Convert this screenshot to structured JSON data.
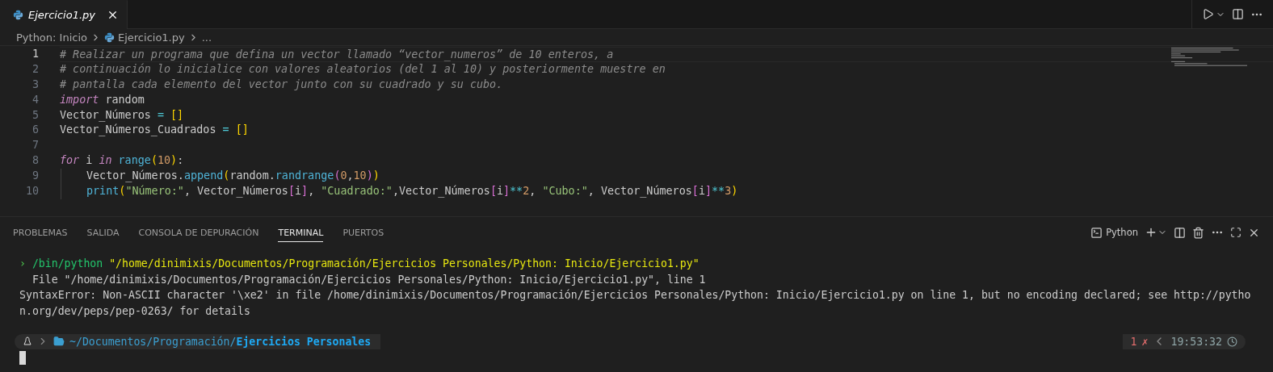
{
  "editor_tabs": [
    {
      "label": "Ejercicio1.py",
      "selected": true
    }
  ],
  "breadcrumb": [
    "Python: Inicio",
    "Ejercicio1.py",
    "..."
  ],
  "code_lines": [
    {
      "number": "1",
      "current": true,
      "indented": false,
      "tokens": [
        {
          "kind": "comment",
          "t": "# Realizar un programa que defina un vector llamado “vector_numeros” de 10 enteros, a"
        }
      ]
    },
    {
      "number": "2",
      "current": false,
      "indented": false,
      "tokens": [
        {
          "kind": "comment",
          "t": "# continuación lo inicialice con valores aleatorios (del 1 al 10) y posteriormente muestre en"
        }
      ]
    },
    {
      "number": "3",
      "current": false,
      "indented": false,
      "tokens": [
        {
          "kind": "comment",
          "t": "# pantalla cada elemento del vector junto con su cuadrado y su cubo."
        }
      ]
    },
    {
      "number": "4",
      "current": false,
      "indented": false,
      "tokens": [
        {
          "kind": "keyword",
          "t": "import"
        },
        {
          "kind": "plain",
          "t": " random"
        }
      ]
    },
    {
      "number": "5",
      "current": false,
      "indented": false,
      "tokens": [
        {
          "kind": "plain",
          "t": "Vector_Números "
        },
        {
          "kind": "operator",
          "t": "= "
        },
        {
          "kind": "bracket",
          "t": "[]"
        }
      ]
    },
    {
      "number": "6",
      "current": false,
      "indented": false,
      "tokens": [
        {
          "kind": "plain",
          "t": "Vector_Números_Cuadrados "
        },
        {
          "kind": "operator",
          "t": "= "
        },
        {
          "kind": "bracket",
          "t": "[]"
        }
      ]
    },
    {
      "number": "7",
      "current": false,
      "indented": false
    },
    {
      "number": "8",
      "current": false,
      "indented": false,
      "tokens": [
        {
          "kind": "keyword",
          "t": "for"
        },
        {
          "kind": "plain",
          "t": " i "
        },
        {
          "kind": "keyword",
          "t": "in"
        },
        {
          "kind": "function",
          "t": " range"
        },
        {
          "kind": "bracket",
          "t": "("
        },
        {
          "kind": "number",
          "t": "10"
        },
        {
          "kind": "bracket",
          "t": ")"
        },
        {
          "kind": "plain",
          "t": ":"
        }
      ]
    },
    {
      "number": "9",
      "current": false,
      "indented": true,
      "tokens": [
        {
          "kind": "plain",
          "t": "Vector_Números."
        },
        {
          "kind": "function",
          "t": "append"
        },
        {
          "kind": "bracket",
          "t": "("
        },
        {
          "kind": "plain",
          "t": "random."
        },
        {
          "kind": "function",
          "t": "randrange"
        },
        {
          "kind": "bracket2",
          "t": "("
        },
        {
          "kind": "number",
          "t": "0"
        },
        {
          "kind": "plain",
          "t": ","
        },
        {
          "kind": "number",
          "t": "10"
        },
        {
          "kind": "bracket2",
          "t": ")"
        },
        {
          "kind": "bracket",
          "t": ")"
        }
      ]
    },
    {
      "number": "10",
      "current": false,
      "indented": true,
      "tokens": [
        {
          "kind": "function",
          "t": "print"
        },
        {
          "kind": "bracket",
          "t": "("
        },
        {
          "kind": "string",
          "t": "\"Número:\""
        },
        {
          "kind": "plain",
          "t": ", Vector_Números"
        },
        {
          "kind": "bracket2",
          "t": "["
        },
        {
          "kind": "plain",
          "t": "i"
        },
        {
          "kind": "bracket2",
          "t": "]"
        },
        {
          "kind": "plain",
          "t": ", "
        },
        {
          "kind": "string",
          "t": "\"Cuadrado:\""
        },
        {
          "kind": "plain",
          "t": ",Vector_Números"
        },
        {
          "kind": "bracket2",
          "t": "["
        },
        {
          "kind": "plain",
          "t": "i"
        },
        {
          "kind": "bracket2",
          "t": "]"
        },
        {
          "kind": "operator",
          "t": "**"
        },
        {
          "kind": "number",
          "t": "2"
        },
        {
          "kind": "plain",
          "t": ", "
        },
        {
          "kind": "string",
          "t": "\"Cubo:\""
        },
        {
          "kind": "plain",
          "t": ", Vector_Números"
        },
        {
          "kind": "bracket2",
          "t": "["
        },
        {
          "kind": "plain",
          "t": "i"
        },
        {
          "kind": "bracket2",
          "t": "]"
        },
        {
          "kind": "operator",
          "t": "**"
        },
        {
          "kind": "number",
          "t": "3"
        },
        {
          "kind": "bracket",
          "t": ")"
        }
      ]
    }
  ],
  "panel_tabs": [
    {
      "label": "PROBLEMAS",
      "selected": false
    },
    {
      "label": "SALIDA",
      "selected": false
    },
    {
      "label": "CONSOLA DE DEPURACIÓN",
      "selected": false
    },
    {
      "label": "TERMINAL",
      "selected": true
    },
    {
      "label": "PUERTOS",
      "selected": false
    }
  ],
  "terminal_name": "Python",
  "terminal_lines": [
    [
      {
        "kind": "prompt",
        "t": "›"
      },
      {
        "kind": "command",
        "t": " /bin/python "
      },
      {
        "kind": "arg",
        "t": "\"/home/dinimixis/Documentos/Programación/Ejercicios Personales/Python: Inicio/Ejercicio1.py\""
      }
    ],
    [
      {
        "kind": "output",
        "t": "  File \"/home/dinimixis/Documentos/Programación/Ejercicios Personales/Python: Inicio/Ejercicio1.py\", line 1"
      }
    ],
    [
      {
        "kind": "output",
        "t": "SyntaxError: Non-ASCII character '\\xe2' in file /home/dinimixis/Documentos/Programación/Ejercicios Personales/Python: Inicio/Ejercicio1.py on line 1, but no encoding declared; see http://pytho"
      }
    ],
    [
      {
        "kind": "output",
        "t": "n.org/dev/peps/pep-0263/ for details"
      }
    ]
  ],
  "prompt": {
    "path_dim": "~/Documentos/Programación/",
    "path_bold": "Ejercicios Personales",
    "error_count": "1",
    "error_mark": "✗",
    "time": "19:53:32"
  }
}
